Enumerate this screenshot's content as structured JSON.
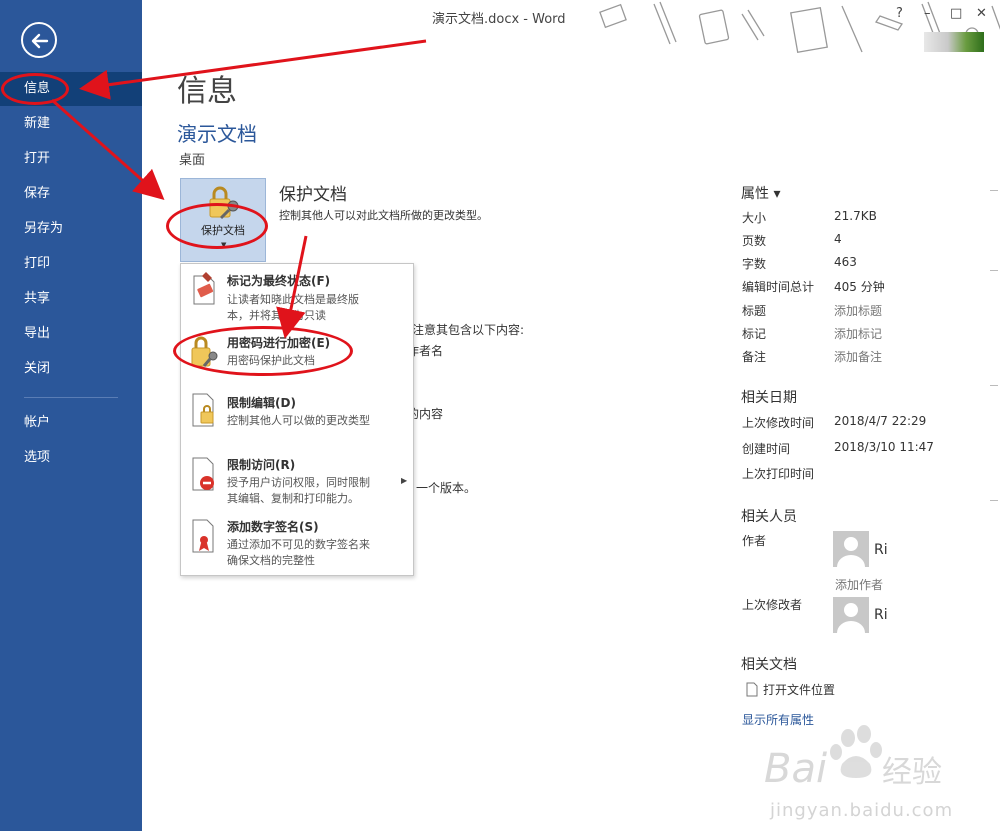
{
  "window": {
    "title": "演示文档.docx - Word",
    "controls": [
      "?",
      "–",
      "□",
      "✕"
    ]
  },
  "nav": {
    "back_icon": "arrow-left-icon",
    "items": [
      "信息",
      "新建",
      "打开",
      "保存",
      "另存为",
      "打印",
      "共享",
      "导出",
      "关闭"
    ],
    "items2": [
      "帐户",
      "选项"
    ],
    "active": "信息"
  },
  "main": {
    "heading": "信息",
    "doc_name": "演示文档",
    "doc_path": "桌面"
  },
  "protect": {
    "tile_label": "保护文档",
    "title": "保护文档",
    "desc": "控制其他人可以对此文档所做的更改类型。"
  },
  "background_text": {
    "inspect_fragment": "请注意其包含以下内容:",
    "author_fragment": "作者名",
    "content_fragment": "的内容",
    "version_fragment": "一个版本。"
  },
  "dropdown": {
    "items": [
      {
        "title": "标记为最终状态(F)",
        "desc": [
          "让读者知晓此文档是最终版",
          "本，并将其设为只读"
        ],
        "icon": "mark-final-icon"
      },
      {
        "title": "用密码进行加密(E)",
        "desc": [
          "用密码保护此文档"
        ],
        "icon": "lock-key-icon"
      },
      {
        "title": "限制编辑(D)",
        "desc": [
          "控制其他人可以做的更改类型"
        ],
        "icon": "restrict-edit-icon"
      },
      {
        "title": "限制访问(R)",
        "desc": [
          "授予用户访问权限，同时限制",
          "其编辑、复制和打印能力。"
        ],
        "icon": "restrict-access-icon"
      },
      {
        "title": "添加数字签名(S)",
        "desc": [
          "通过添加不可见的数字签名来",
          "确保文档的完整性"
        ],
        "icon": "signature-icon"
      }
    ]
  },
  "properties": {
    "heading": "属性 ▾",
    "rows": [
      {
        "label": "大小",
        "value": "21.7KB"
      },
      {
        "label": "页数",
        "value": "4"
      },
      {
        "label": "字数",
        "value": "463"
      },
      {
        "label": "编辑时间总计",
        "value": "405 分钟"
      },
      {
        "label": "标题",
        "value": "添加标题"
      },
      {
        "label": "标记",
        "value": "添加标记"
      },
      {
        "label": "备注",
        "value": "添加备注"
      }
    ]
  },
  "related_dates": {
    "heading": "相关日期",
    "rows": [
      {
        "label": "上次修改时间",
        "value": "2018/4/7 22:29"
      },
      {
        "label": "创建时间",
        "value": "2018/3/10 11:47"
      },
      {
        "label": "上次打印时间",
        "value": ""
      }
    ]
  },
  "related_people": {
    "heading": "相关人员",
    "author_label": "作者",
    "author_name": "Ri",
    "add_author": "添加作者",
    "last_modified_label": "上次修改者",
    "last_modified_name": "Ri"
  },
  "related_docs": {
    "heading": "相关文档",
    "open_location": "打开文件位置",
    "show_all": "显示所有属性"
  },
  "watermark": {
    "text": "jingyan.baidu.com",
    "logo_text": "Bai du 经验"
  },
  "colors": {
    "nav_bg": "#2b579a",
    "nav_active": "#124078",
    "accent": "#2b579a",
    "annotation_red": "#e0131b",
    "tile_bg": "#c5d6ec"
  }
}
